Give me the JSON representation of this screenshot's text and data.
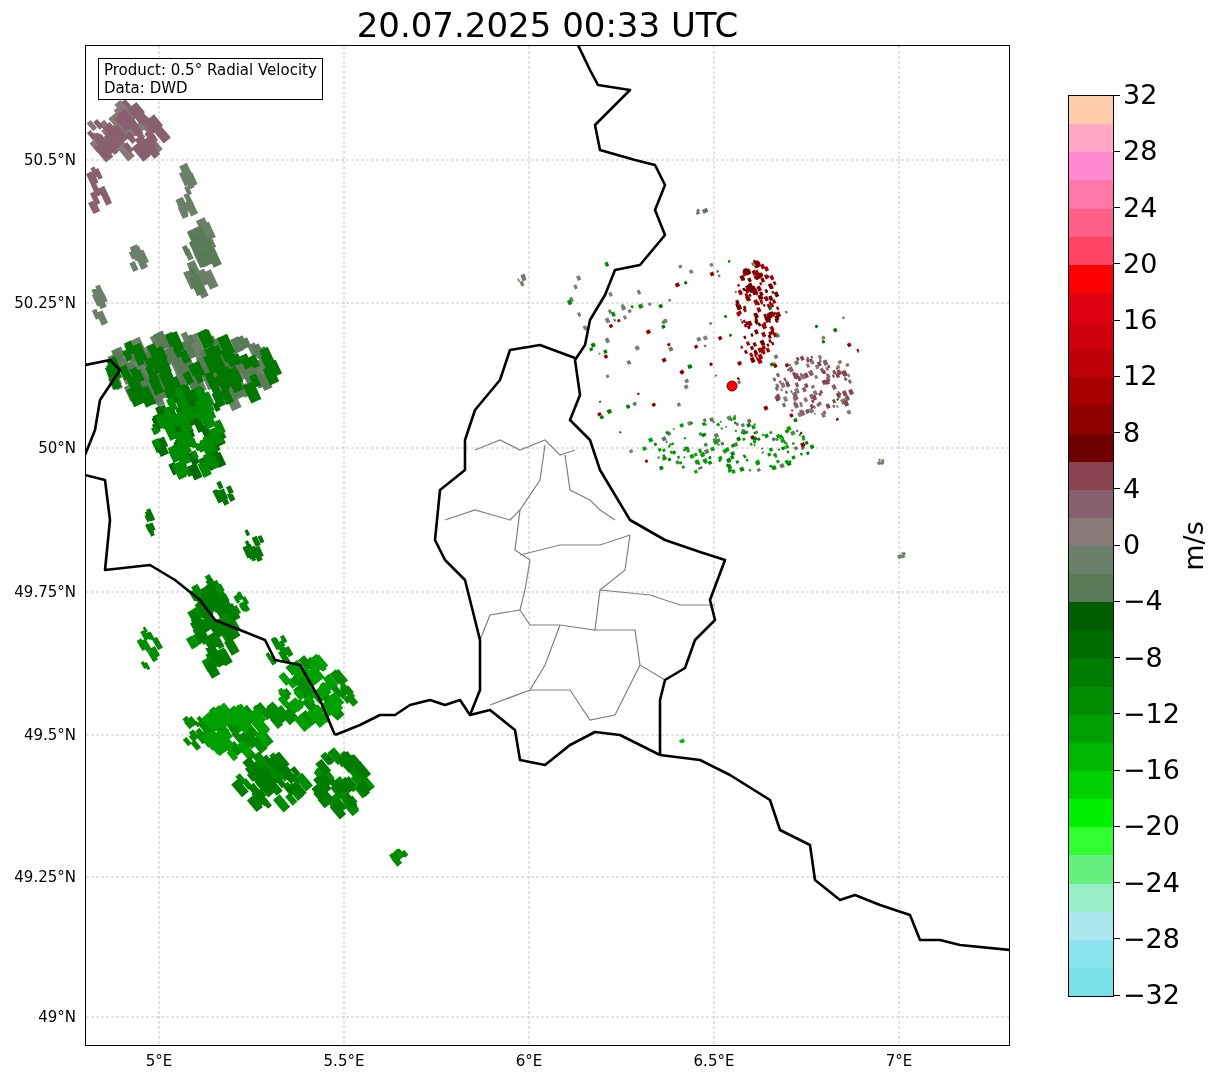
{
  "title": "20.07.2025 00:33 UTC",
  "info_box": {
    "lines": [
      "Product: 0.5° Radial Velocity",
      "Data: DWD"
    ]
  },
  "map": {
    "x_ticks": [
      "5°E",
      "5.5°E",
      "6°E",
      "6.5°E",
      "7°E"
    ],
    "y_ticks": [
      "50.5°N",
      "50.25°N",
      "50°N",
      "49.75°N",
      "49.5°N",
      "49.25°N",
      "49°N"
    ]
  },
  "colorbar": {
    "label": "m/s",
    "ticks": [
      "32",
      "28",
      "24",
      "20",
      "16",
      "12",
      "8",
      "4",
      "0",
      "−4",
      "−8",
      "−12",
      "−16",
      "−20",
      "−24",
      "−28",
      "−32"
    ],
    "segments": [
      {
        "color": "#ffcdaa"
      },
      {
        "color": "#ffa8c6"
      },
      {
        "color": "#ff88d0"
      },
      {
        "color": "#ff77a8"
      },
      {
        "color": "#ff6088"
      },
      {
        "color": "#ff4466"
      },
      {
        "color": "#ff0000"
      },
      {
        "color": "#e00010"
      },
      {
        "color": "#d2000c"
      },
      {
        "color": "#c00008"
      },
      {
        "color": "#a80000"
      },
      {
        "color": "#900000"
      },
      {
        "color": "#700000"
      },
      {
        "color": "#884450"
      },
      {
        "color": "#886070"
      },
      {
        "color": "#887878"
      },
      {
        "color": "#6a8068"
      },
      {
        "color": "#5a7a58"
      },
      {
        "color": "#005e00"
      },
      {
        "color": "#006c00"
      },
      {
        "color": "#007c00"
      },
      {
        "color": "#008c00"
      },
      {
        "color": "#00a000"
      },
      {
        "color": "#00b800"
      },
      {
        "color": "#00d000"
      },
      {
        "color": "#00f000"
      },
      {
        "color": "#30ff30"
      },
      {
        "color": "#66f080"
      },
      {
        "color": "#99eec8"
      },
      {
        "color": "#aae8ee"
      },
      {
        "color": "#8ae4ee"
      },
      {
        "color": "#77e0e8"
      }
    ]
  }
}
